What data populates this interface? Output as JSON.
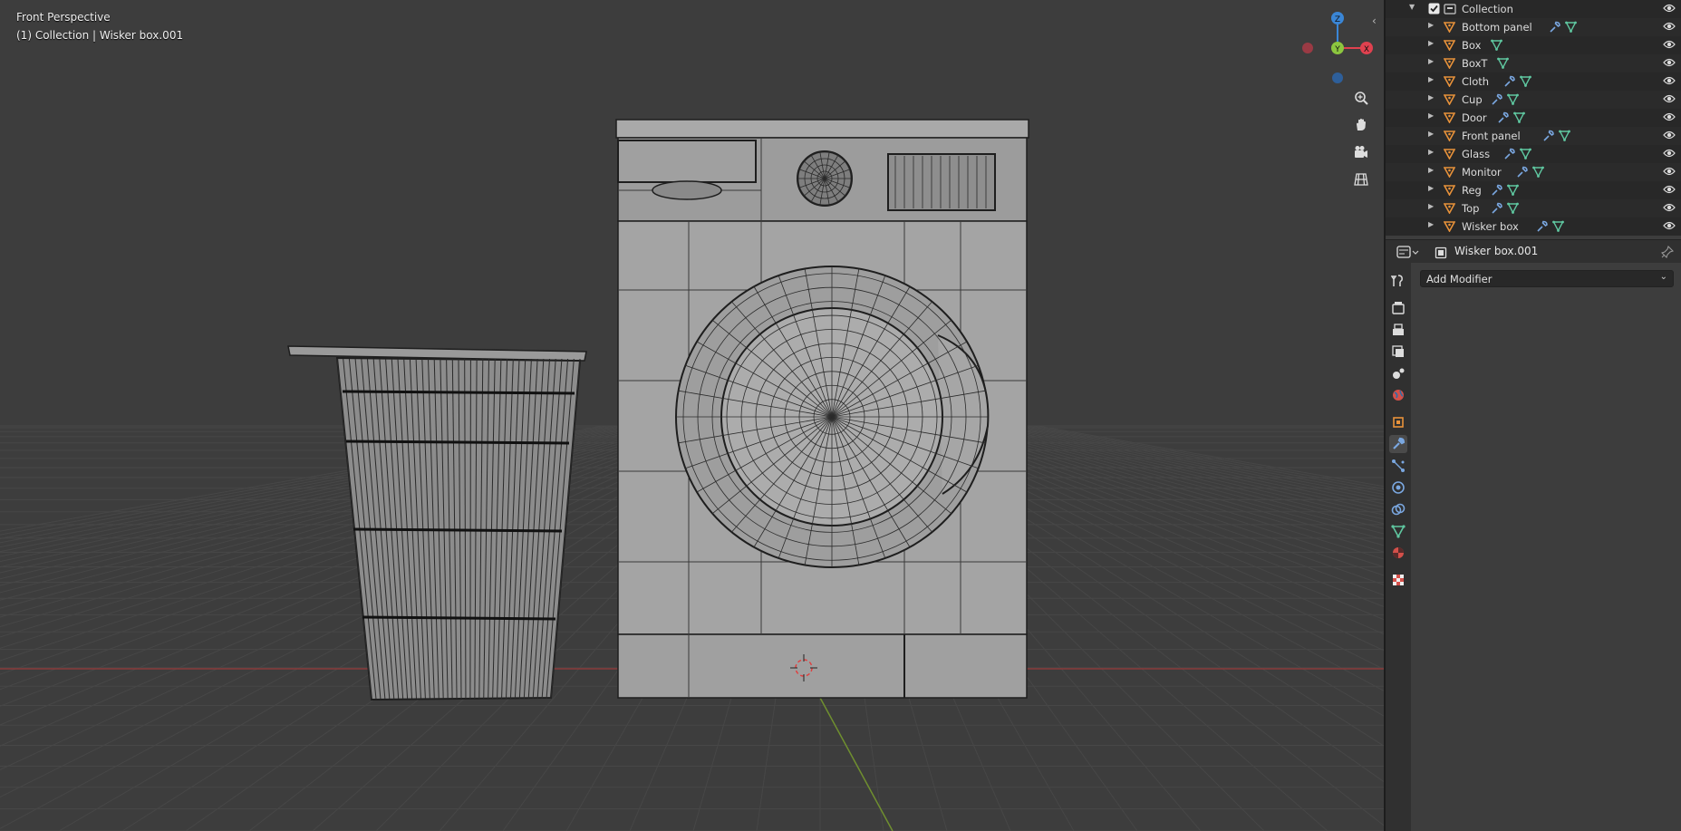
{
  "viewport": {
    "view_name": "Front Perspective",
    "active_info": "(1) Collection | Wisker box.001",
    "gizmo": {
      "z_label": "Z",
      "y_label": "Y",
      "x_label": "X"
    }
  },
  "outliner": {
    "collection_label": "Collection",
    "items": [
      {
        "name": "Bottom panel",
        "has_modifier": true
      },
      {
        "name": "Box",
        "has_modifier": false
      },
      {
        "name": "BoxT",
        "has_modifier": false
      },
      {
        "name": "Cloth",
        "has_modifier": true
      },
      {
        "name": "Cup",
        "has_modifier": true
      },
      {
        "name": "Door",
        "has_modifier": true
      },
      {
        "name": "Front panel",
        "has_modifier": true
      },
      {
        "name": "Glass",
        "has_modifier": true
      },
      {
        "name": "Monitor",
        "has_modifier": true
      },
      {
        "name": "Reg",
        "has_modifier": true
      },
      {
        "name": "Top",
        "has_modifier": true
      },
      {
        "name": "Wisker box",
        "has_modifier": true
      }
    ]
  },
  "properties": {
    "object_name": "Wisker box.001",
    "add_modifier_label": "Add Modifier",
    "active_tab": "modifier",
    "tabs": [
      "tool-icon",
      "render-icon",
      "output-icon",
      "view-layer-icon",
      "scene-icon",
      "world-icon",
      "object-icon",
      "modifier-icon",
      "particles-icon",
      "physics-icon",
      "constraints-icon",
      "data-icon",
      "material-icon",
      "texture-icon"
    ]
  },
  "colors": {
    "axis_x": "#e0414f",
    "axis_y": "#8cc63f",
    "axis_z": "#3a86d6",
    "mesh_orange": "#e8923a",
    "mesh_green": "#5fc7a0",
    "wrench_blue": "#7aa7e0"
  }
}
